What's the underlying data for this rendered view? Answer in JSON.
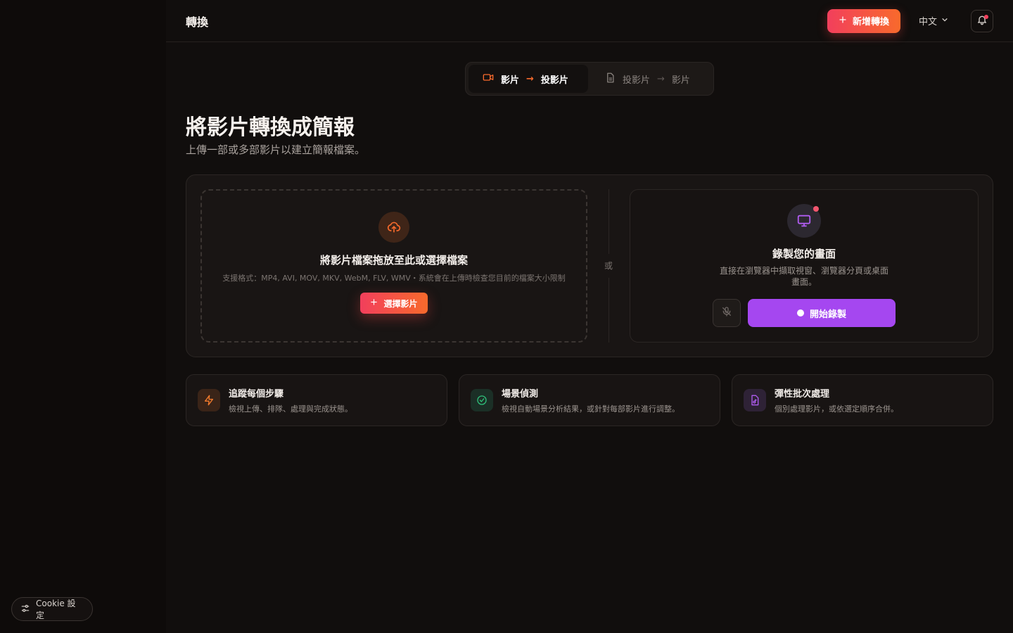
{
  "header": {
    "title": "轉換",
    "new_button": "新增轉換",
    "language": "中文"
  },
  "mode_switch": {
    "active": {
      "from": "影片",
      "to": "投影片"
    },
    "inactive": {
      "from": "投影片",
      "to": "影片"
    }
  },
  "page": {
    "title": "將影片轉換成簡報",
    "subtitle": "上傳一部或多部影片以建立簡報檔案。"
  },
  "upload": {
    "title": "將影片檔案拖放至此或選擇檔案",
    "description": "支援格式：MP4, AVI, MOV, MKV, WebM, FLV, WMV・系統會在上傳時檢查您目前的檔案大小限制",
    "button": "選擇影片",
    "or": "或"
  },
  "record": {
    "title": "錄製您的畫面",
    "description": "直接在瀏覽器中擷取視窗、瀏覽器分頁或桌面畫面。",
    "button": "開始錄製"
  },
  "features": [
    {
      "title": "追蹤每個步驟",
      "description": "檢視上傳、排隊、處理與完成狀態。",
      "icon": "bolt-icon",
      "color": "#f27a2c"
    },
    {
      "title": "場景偵測",
      "description": "檢視自動場景分析結果，或針對每部影片進行調整。",
      "icon": "check-circle-icon",
      "color": "#2fbf7a"
    },
    {
      "title": "彈性批次處理",
      "description": "個別處理影片，或依選定順序合併。",
      "icon": "file-music-icon",
      "color": "#b05cf0"
    }
  ],
  "cookie": {
    "label": "Cookie 設定"
  },
  "colors": {
    "accent_start": "#f23f5c",
    "accent_end": "#f86a2c",
    "record": "#a547f0",
    "background": "#110e0d"
  }
}
